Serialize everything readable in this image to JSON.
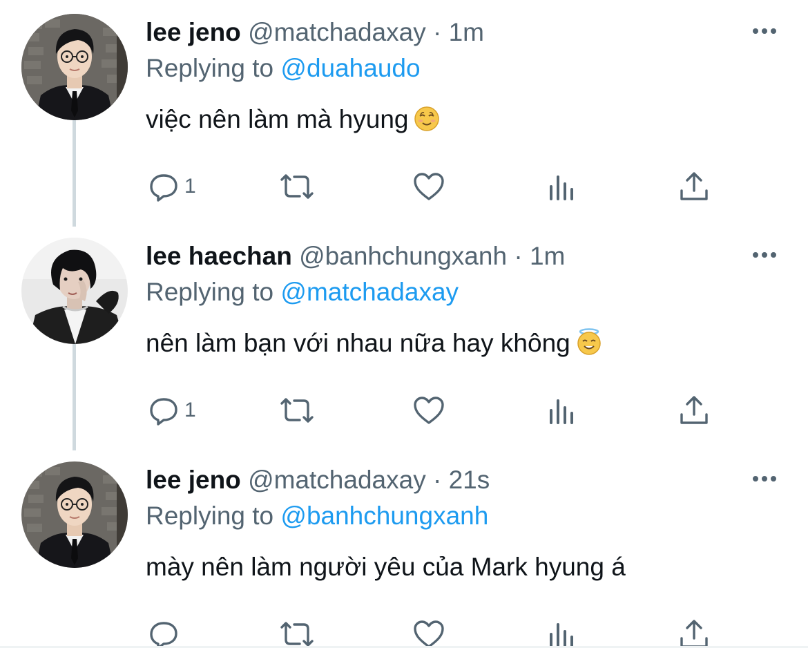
{
  "colors": {
    "primary_text": "#0f1419",
    "secondary_text": "#536471",
    "link": "#1d9bf0",
    "thread_line": "#cfd9de"
  },
  "tweets": [
    {
      "name": "lee jeno",
      "handle": "@matchadaxay",
      "separator": "·",
      "time": "1m",
      "replying_prefix": "Replying to",
      "replying_handle": "@duahaudo",
      "text": "việc nên làm mà hyung",
      "emoji": "relieved-smiling-face-emoji",
      "reply_count": "1",
      "avatar": "avatar-glasses-suit"
    },
    {
      "name": "lee haechan",
      "handle": "@banhchungxanh",
      "separator": "·",
      "time": "1m",
      "replying_prefix": "Replying to",
      "replying_handle": "@matchadaxay",
      "text": "nên làm bạn với nhau nữa hay không",
      "emoji": "smiling-face-with-halo-emoji",
      "reply_count": "1",
      "avatar": "avatar-dark-hair-jacket"
    },
    {
      "name": "lee jeno",
      "handle": "@matchadaxay",
      "separator": "·",
      "time": "21s",
      "replying_prefix": "Replying to",
      "replying_handle": "@banhchungxanh",
      "text": "mày nên làm người yêu của Mark hyung á",
      "emoji": "",
      "reply_count": "",
      "avatar": "avatar-glasses-suit"
    }
  ],
  "icons": {
    "reply": "reply-icon",
    "retweet": "retweet-icon",
    "like": "like-icon",
    "views": "analytics-icon",
    "share": "share-icon",
    "more": "more-options-icon"
  }
}
